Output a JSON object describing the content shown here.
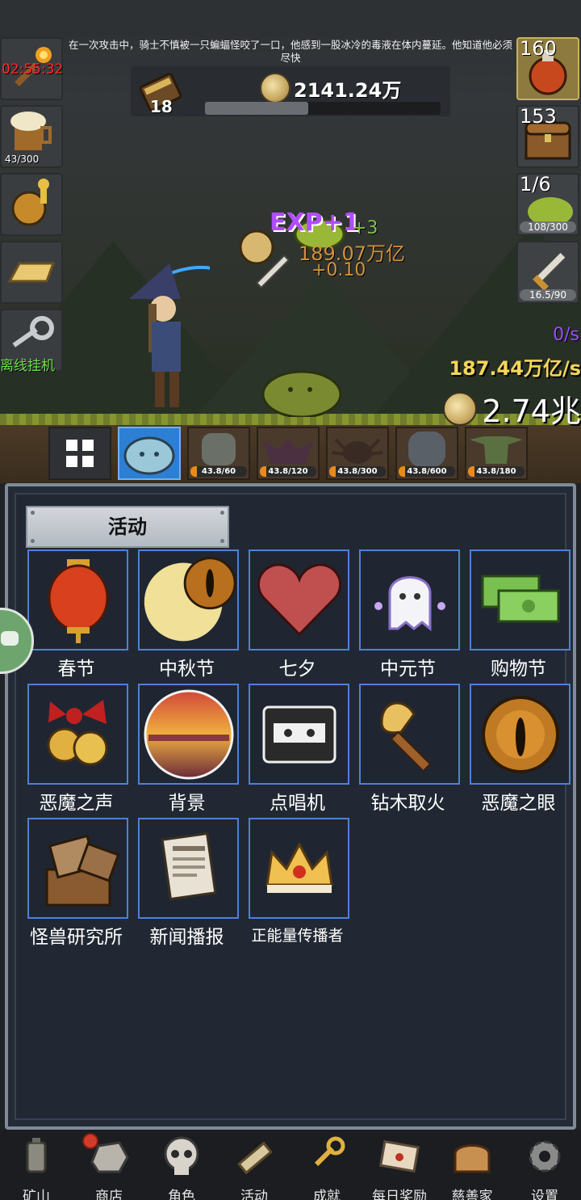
{
  "story_text": "在一次攻击中，骑士不慎被一只蝙蝠怪咬了一口，他感到一股冰冷的毒液在体内蔓延。他知道他必须尽快",
  "hud": {
    "book_count": "18",
    "gold": "2141.24万",
    "gold_bar_fraction": 0.44,
    "timer": "02:55:32",
    "offline_label": "离线挂机",
    "left_slots": [
      {
        "icon": "torch-icon",
        "text": ""
      },
      {
        "icon": "beer-mug-icon",
        "text": "43/300"
      },
      {
        "icon": "golden-key-icon",
        "text": ""
      },
      {
        "icon": "gold-bar-icon",
        "text": ""
      },
      {
        "icon": "silver-key-icon",
        "text": ""
      }
    ],
    "right_slots": [
      {
        "icon": "potion-icon",
        "count": "160",
        "bar": ""
      },
      {
        "icon": "treasure-chest-icon",
        "count": "153",
        "bar": ""
      },
      {
        "icon": "slime-icon",
        "count": "1/6",
        "bar": "108/300"
      },
      {
        "icon": "sword-icon",
        "count": "",
        "bar": "16.5/90"
      }
    ],
    "exp_rate": "0/s",
    "gold_rate": "187.44万亿/s",
    "total_gold": "2.74兆",
    "floating_exp": "EXP+1",
    "floating_plus": "+3",
    "floating_gold": "189.07万亿",
    "floating_decimal": "+0.10"
  },
  "monsters": [
    {
      "icon": "blue-slime-icon",
      "progress": "",
      "active": true
    },
    {
      "icon": "zombie-icon",
      "progress": "43.8/60",
      "active": false
    },
    {
      "icon": "bat-icon",
      "progress": "43.8/120",
      "active": false
    },
    {
      "icon": "spider-icon",
      "progress": "43.8/300",
      "active": false
    },
    {
      "icon": "ghoul-icon",
      "progress": "43.8/600",
      "active": false
    },
    {
      "icon": "goblin-icon",
      "progress": "43.8/180",
      "active": false
    }
  ],
  "panel": {
    "title": "活动",
    "activities": [
      {
        "label": "春节",
        "icon": "lantern-icon"
      },
      {
        "label": "中秋节",
        "icon": "moon-eye-icon"
      },
      {
        "label": "七夕",
        "icon": "heart-icon"
      },
      {
        "label": "中元节",
        "icon": "ghost-icon"
      },
      {
        "label": "购物节",
        "icon": "cash-icon"
      },
      {
        "label": "恶魔之声",
        "icon": "bell-bow-icon"
      },
      {
        "label": "背景",
        "icon": "sunset-icon"
      },
      {
        "label": "点唱机",
        "icon": "cassette-icon"
      },
      {
        "label": "钻木取火",
        "icon": "fire-stick-icon"
      },
      {
        "label": "恶魔之眼",
        "icon": "demon-eye-icon"
      },
      {
        "label": "怪兽研究所",
        "icon": "lab-crate-icon"
      },
      {
        "label": "新闻播报",
        "icon": "newspaper-icon"
      },
      {
        "label": "正能量传播者",
        "icon": "crown-icon"
      }
    ]
  },
  "nav": [
    {
      "label": "矿山",
      "icon": "lantern-nav-icon"
    },
    {
      "label": "商店",
      "icon": "ore-icon"
    },
    {
      "label": "角色",
      "icon": "skull-icon"
    },
    {
      "label": "活动",
      "icon": "scroll-icon"
    },
    {
      "label": "成就",
      "icon": "key-icon"
    },
    {
      "label": "每日奖励",
      "icon": "envelope-icon"
    },
    {
      "label": "慈善家",
      "icon": "bread-icon"
    },
    {
      "label": "设置",
      "icon": "gear-icon"
    }
  ],
  "colors": {
    "panel_border": "#7f8b98",
    "tile_border": "#4f80d8",
    "exp_purple": "#9b4dff",
    "gold_yellow": "#f5d55a",
    "timer_red": "#ff2a2a",
    "offline_green": "#6ee04a"
  }
}
